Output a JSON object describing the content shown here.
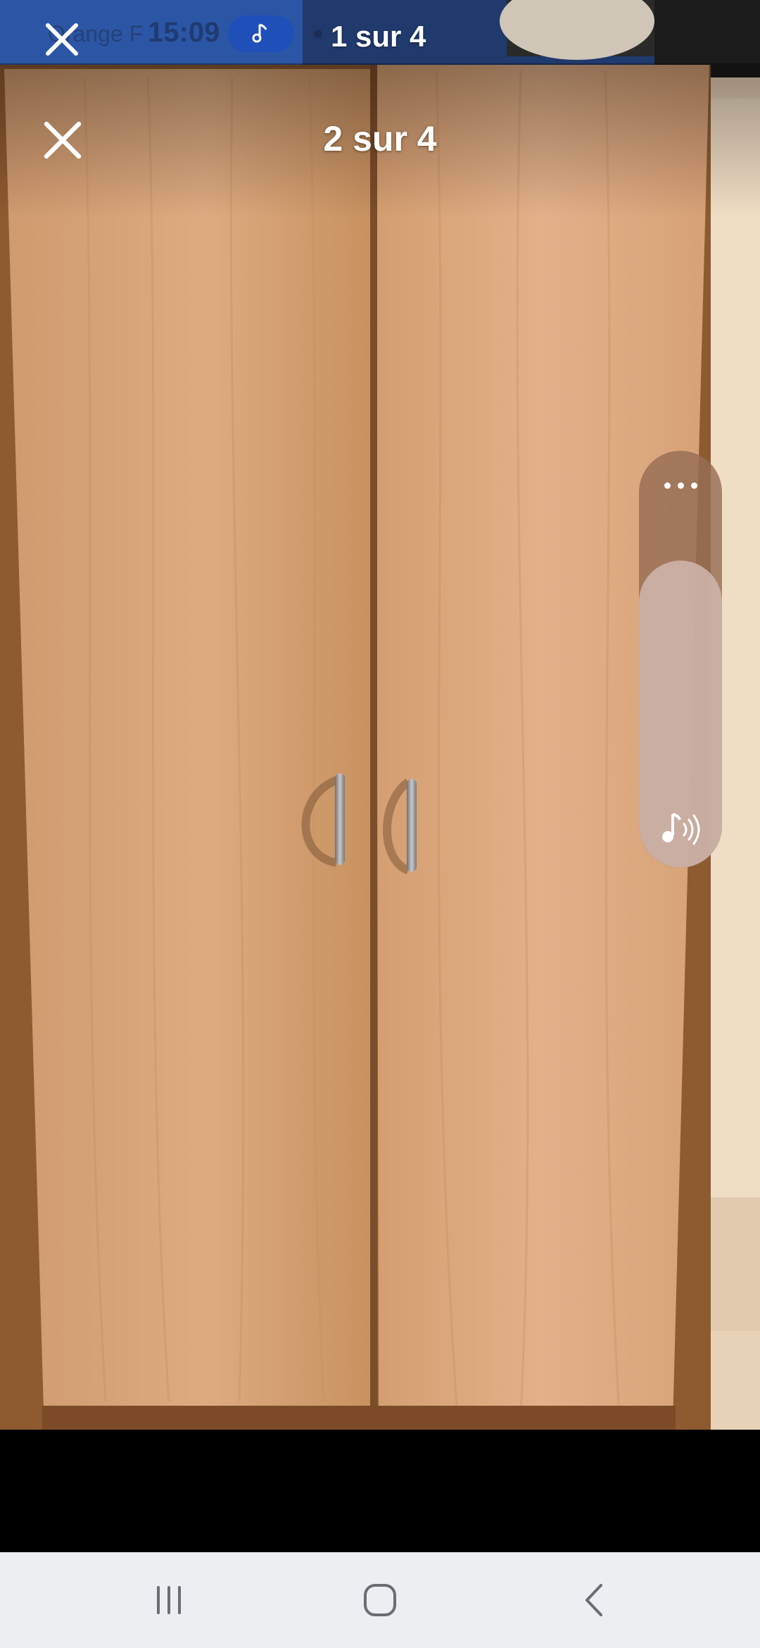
{
  "status_bar": {
    "carrier": "Orange F",
    "time": "15:09"
  },
  "ghost_header": {
    "counter": "1 sur 4"
  },
  "viewer": {
    "counter": "2 sur 4",
    "close_icon": "close-icon"
  },
  "volume_panel": {
    "more_icon": "more-horizontal-icon",
    "media_icon": "music-volume-icon",
    "level": 0.82
  },
  "nav_bar": {
    "recents_icon": "recents-icon",
    "home_icon": "home-icon",
    "back_icon": "back-icon"
  },
  "colors": {
    "wood": "#d9a57a",
    "music_pill": "#1f4fb8",
    "nav_bar_bg": "#eceef1"
  }
}
